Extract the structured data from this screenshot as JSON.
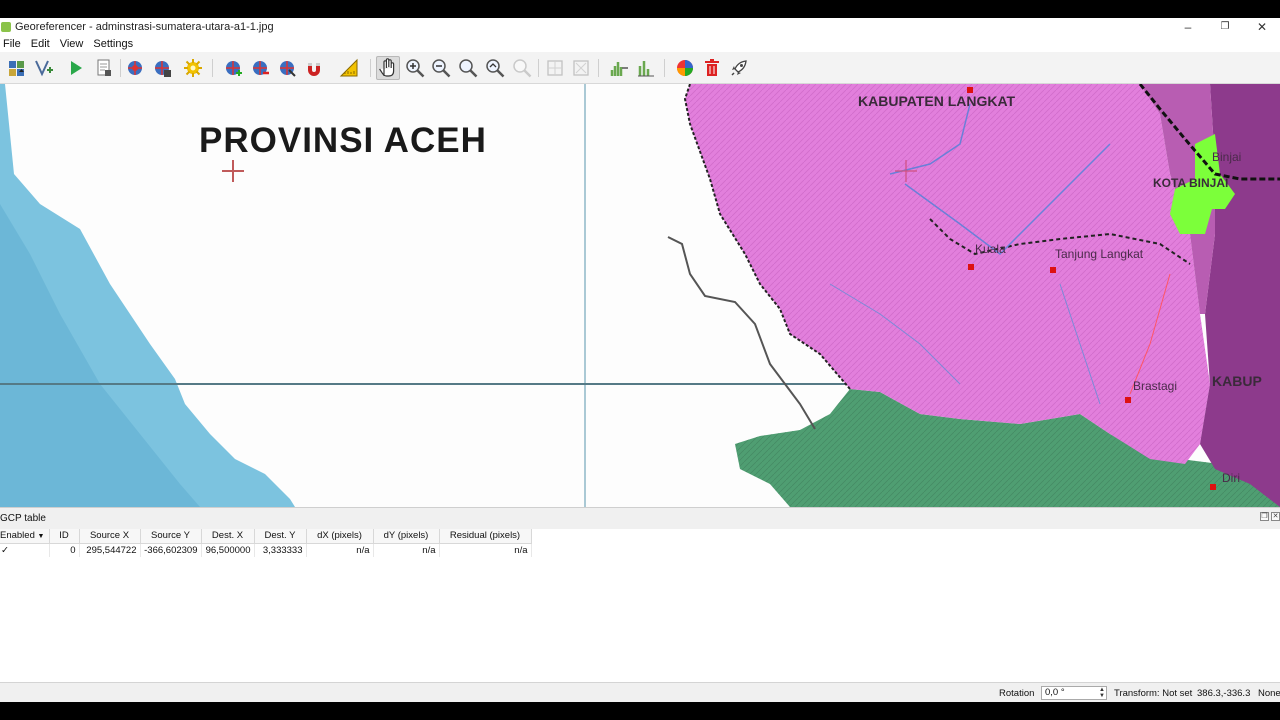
{
  "window": {
    "title": "Georeferencer - adminstrasi-sumatera-utara-a1-1.jpg",
    "minimize": "–",
    "maximize": "❐",
    "close": "✕"
  },
  "menu": [
    "File",
    "Edit",
    "View",
    "Settings"
  ],
  "toolbar": {
    "icons": [
      "open-raster-icon",
      "start-georeferencing-icon",
      "run-icon",
      "generate-gdal-script-icon",
      "load-gcp-points-icon",
      "save-gcp-points-icon",
      "transformation-settings-icon",
      "add-point-icon",
      "delete-point-icon",
      "move-point-icon",
      "snap-icon",
      "measure-icon",
      "pan-icon",
      "zoom-in-icon",
      "zoom-out-icon",
      "zoom-to-layer-icon",
      "zoom-last-icon",
      "zoom-next-icon",
      "link-georeferencer-icon",
      "link-qgis-icon",
      "histogram-stretch-icon",
      "histogram-full-icon",
      "color-icon",
      "delete-all-icon",
      "rocket-icon"
    ]
  },
  "map": {
    "title": "PROVINSI ACEH",
    "labels": {
      "langkat": "KABUPATEN LANGKAT",
      "binjai": "Binjai",
      "stabat": "KOTA BINJAI",
      "kuala": "Kuala",
      "tanjung": "Tanjung Langkat",
      "kabu": "KABUP",
      "brastagi": "Brastagi",
      "diri": "Diri"
    }
  },
  "gcp": {
    "panel_title": "GCP table",
    "columns": [
      "Enabled",
      "ID",
      "Source X",
      "Source Y",
      "Dest. X",
      "Dest. Y",
      "dX (pixels)",
      "dY (pixels)",
      "Residual (pixels)"
    ],
    "rows": [
      {
        "enabled": "✓",
        "id": "0",
        "source_x": "295,544722",
        "source_y": "-366,602309",
        "dest_x": "96,500000",
        "dest_y": "3,333333",
        "dx": "n/a",
        "dy": "n/a",
        "residual": "n/a"
      }
    ]
  },
  "status": {
    "rotation_label": "Rotation",
    "rotation_value": "0,0 °",
    "transform": "Transform: Not set",
    "coords": "386.3,-336.3",
    "crs": "None"
  },
  "colors": {
    "sea": "#7cc3df",
    "langkat_pink": "#e27fdc",
    "dark_purple": "#8d3a8c",
    "green": "#4f9e72",
    "lime": "#7cff3a"
  }
}
